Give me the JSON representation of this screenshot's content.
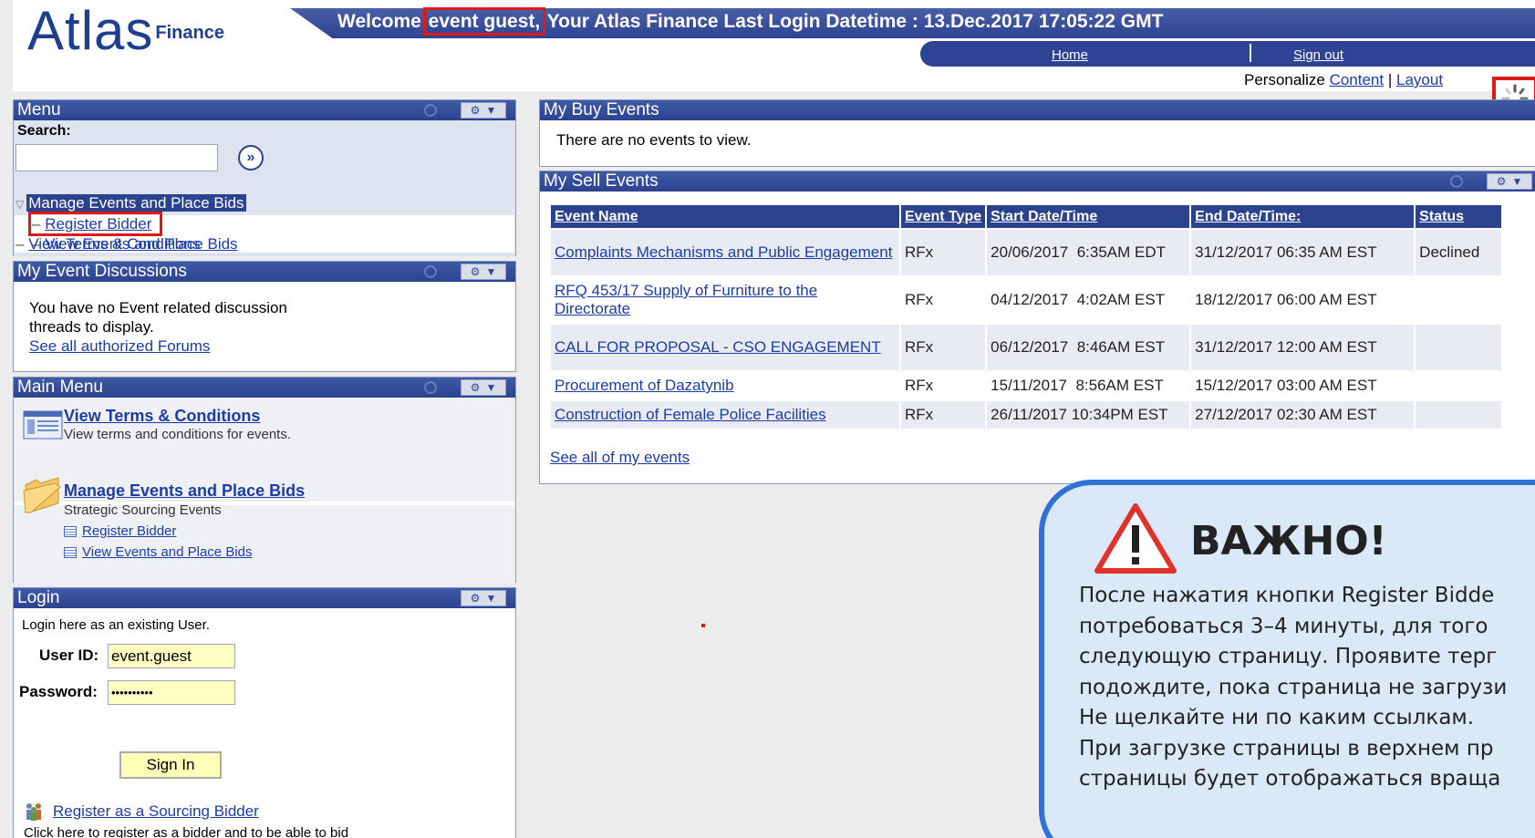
{
  "header": {
    "logo_main": "Atlas",
    "logo_sub": "Finance",
    "welcome_prefix": "Welcome",
    "welcome_user": "event guest,",
    "welcome_suffix": "Your Atlas Finance Last Login Datetime : 13.Dec.2017 17:05:22 GMT",
    "nav_home": "Home",
    "nav_signout": "Sign out",
    "personalize_label": "Personalize",
    "personalize_content": "Content",
    "personalize_sep": "|",
    "personalize_layout": "Layout"
  },
  "menu": {
    "title": "Menu",
    "search_label": "Search:",
    "search_value": "",
    "folder": "Manage Events and Place Bids",
    "register_bidder": "Register Bidder",
    "view_events": "View Events and Place Bids",
    "view_terms": "View Terms & Conditions"
  },
  "discussions": {
    "title": "My Event Discussions",
    "message": "You have no Event related discussion threads to display.",
    "link": "See all authorized Forums"
  },
  "main_menu": {
    "title": "Main Menu",
    "terms_title": "View Terms & Conditions",
    "terms_desc": "View terms and conditions for events.",
    "manage_title": "Manage Events and Place Bids",
    "manage_desc": "Strategic Sourcing Events",
    "sub_register": "Register Bidder",
    "sub_view": "View Events and Place Bids"
  },
  "login": {
    "title": "Login",
    "hint": "Login here as an existing User.",
    "user_label": "User ID:",
    "user_value": "event.guest",
    "password_label": "Password:",
    "password_value": "••••••••••",
    "sign_in": "Sign In",
    "register_link": "Register as a Sourcing Bidder",
    "register_desc": "Click here to register as a bidder and to be able to bid on events."
  },
  "buy_events": {
    "title": "My Buy Events",
    "message": "There are no events to view."
  },
  "sell_events": {
    "title": "My Sell Events",
    "columns": [
      "Event Name",
      "Event Type",
      "Start Date/Time",
      "End Date/Time:",
      "Status"
    ],
    "rows": [
      {
        "name": "Complaints Mechanisms and Public Engagement",
        "type": "RFx",
        "start": "20/06/2017  6:35AM EDT",
        "end": "31/12/2017 06:35 AM EST",
        "status": "Declined"
      },
      {
        "name": "RFQ 453/17 Supply of Furniture to the Directorate",
        "type": "RFx",
        "start": "04/12/2017  4:02AM EST",
        "end": "18/12/2017 06:00 AM EST",
        "status": ""
      },
      {
        "name": "CALL FOR PROPOSAL - CSO ENGAGEMENT",
        "type": "RFx",
        "start": "06/12/2017  8:46AM EST",
        "end": "31/12/2017 12:00 AM EST",
        "status": ""
      },
      {
        "name": "Procurement of Dazatynib",
        "type": "RFx",
        "start": "15/11/2017  8:56AM EST",
        "end": "15/12/2017 03:00 AM EST",
        "status": ""
      },
      {
        "name": "Construction of Female Police Facilities",
        "type": "RFx",
        "start": "26/11/2017 10:34PM EST",
        "end": "27/12/2017 02:30 AM EST",
        "status": ""
      }
    ],
    "see_all": "See all of my events"
  },
  "callout": {
    "title": "ВАЖНО!",
    "lines": [
      "После нажатия кнопки Register Bidde",
      "потребоваться 3–4 минуты, для того",
      "следующую страницу.  Проявите терг",
      "подождите, пока страница не загрузи",
      "Не щелкайте ни по каким ссылкам.",
      "При загрузке страницы в верхнем пр",
      "страницы будет отображаться враща"
    ]
  },
  "colors": {
    "header_blue": "#2b428f",
    "highlight_red": "#e01818",
    "callout_border": "#2f72d6",
    "callout_fill": "#dbe8f7"
  },
  "icons": [
    "search-go-icon",
    "refresh-icon",
    "gear-icon",
    "chevron-down-icon",
    "loading-spinner-icon",
    "document-icon",
    "folder-icon",
    "bidder-people-icon",
    "warning-icon"
  ]
}
